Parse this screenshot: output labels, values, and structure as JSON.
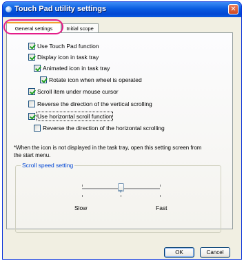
{
  "window": {
    "title": "Touch Pad utility settings",
    "close_glyph": "✕"
  },
  "tabs": [
    {
      "label": "General settings",
      "active": true
    },
    {
      "label": "Initial scope",
      "active": false
    }
  ],
  "options": [
    {
      "label": "Use Touch Pad function",
      "checked": true
    },
    {
      "label": "Display icon in task tray",
      "checked": true
    },
    {
      "label": "Animated icon in task tray",
      "checked": true
    },
    {
      "label": "Rotate icon when wheel is operated",
      "checked": true
    },
    {
      "label": "Scroll item under mouse cursor",
      "checked": true
    },
    {
      "label": "Reverse the direction of the vertical scrolling",
      "checked": false
    },
    {
      "label": "Use horizontal scroll function",
      "checked": true
    },
    {
      "label": "Reverse the direction of the horizontal scrolling",
      "checked": false
    }
  ],
  "note": "*When the icon is not displayed in the task tray, open this setting screen from the start menu.",
  "scroll_speed": {
    "group_label": "Scroll speed setting",
    "slow_label": "Slow",
    "fast_label": "Fast",
    "level_fraction": 0.5
  },
  "buttons": {
    "ok_label": "OK",
    "cancel_label": "Cancel"
  },
  "colors": {
    "title_bar": "#0a5be0",
    "highlight": "#e41d8a",
    "group_label": "#0046d5",
    "check": "#21a121"
  }
}
